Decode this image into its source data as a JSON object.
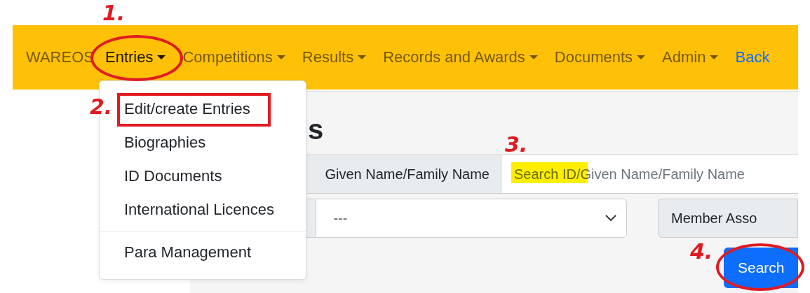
{
  "navbar": {
    "brand": "WAREOS",
    "items": [
      {
        "label": "Entries",
        "kind": "menu",
        "selected": true
      },
      {
        "label": "Competitions",
        "kind": "menu",
        "selected": false
      },
      {
        "label": "Results",
        "kind": "menu",
        "selected": false
      },
      {
        "label": "Records and Awards",
        "kind": "menu",
        "selected": false
      },
      {
        "label": "Documents",
        "kind": "menu",
        "selected": false
      },
      {
        "label": "Admin",
        "kind": "menu",
        "selected": false
      },
      {
        "label": "Back",
        "kind": "link",
        "selected": false
      }
    ]
  },
  "dropdown": {
    "groups": [
      [
        "Edit/create Entries",
        "Biographies",
        "ID Documents",
        "International Licences"
      ],
      [
        "Para Management"
      ]
    ]
  },
  "heading": "s",
  "search": {
    "label": "Given Name/Family Name",
    "placeholder": "Search ID/Given Name/Family Name"
  },
  "select": {
    "value": "---"
  },
  "member_label": "Member Asso",
  "search_button": "Search",
  "annotations": [
    {
      "text": "1.",
      "kind": "ellipse"
    },
    {
      "text": "2.",
      "kind": "box"
    },
    {
      "text": "3.",
      "kind": "highlight"
    },
    {
      "text": "4.",
      "kind": "ellipse"
    }
  ]
}
